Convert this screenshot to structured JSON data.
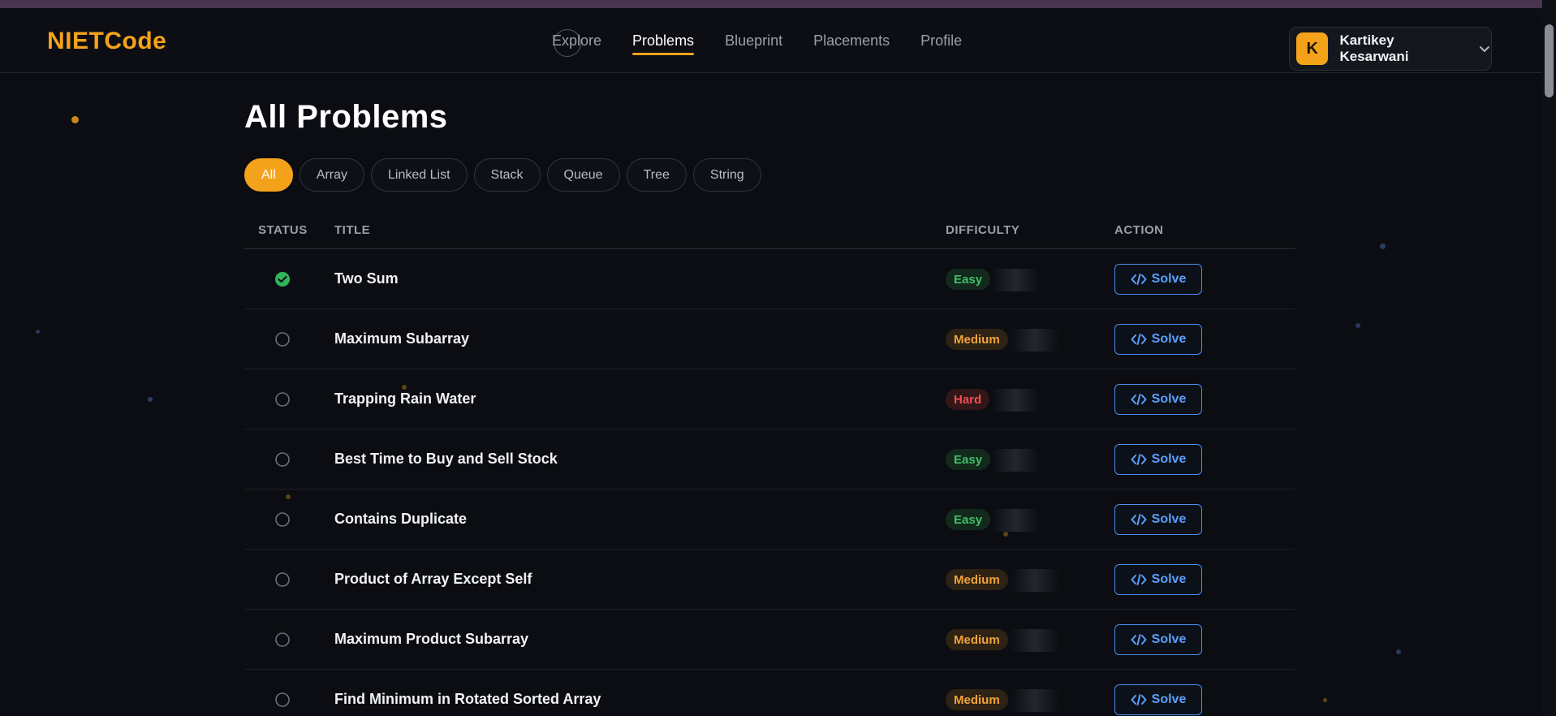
{
  "brand": {
    "name_part1": "NIET",
    "name_part2": "Code"
  },
  "nav": {
    "items": [
      {
        "label": "Explore",
        "active": false
      },
      {
        "label": "Problems",
        "active": true
      },
      {
        "label": "Blueprint",
        "active": false
      },
      {
        "label": "Placements",
        "active": false
      },
      {
        "label": "Profile",
        "active": false
      }
    ]
  },
  "user": {
    "initial": "K",
    "name": "Kartikey Kesarwani"
  },
  "page": {
    "title": "All Problems"
  },
  "filters": [
    "All",
    "Array",
    "Linked List",
    "Stack",
    "Queue",
    "Tree",
    "String"
  ],
  "active_filter": "All",
  "table": {
    "headers": {
      "status": "STATUS",
      "title": "TITLE",
      "difficulty": "DIFFICULTY",
      "action": "ACTION"
    },
    "action_label": "Solve",
    "rows": [
      {
        "status": "solved",
        "title": "Two Sum",
        "difficulty": "Easy"
      },
      {
        "status": "unsolved",
        "title": "Maximum Subarray",
        "difficulty": "Medium"
      },
      {
        "status": "unsolved",
        "title": "Trapping Rain Water",
        "difficulty": "Hard"
      },
      {
        "status": "unsolved",
        "title": "Best Time to Buy and Sell Stock",
        "difficulty": "Easy"
      },
      {
        "status": "unsolved",
        "title": "Contains Duplicate",
        "difficulty": "Easy"
      },
      {
        "status": "unsolved",
        "title": "Product of Array Except Self",
        "difficulty": "Medium"
      },
      {
        "status": "unsolved",
        "title": "Maximum Product Subarray",
        "difficulty": "Medium"
      },
      {
        "status": "unsolved",
        "title": "Find Minimum in Rotated Sorted Array",
        "difficulty": "Medium"
      }
    ]
  },
  "colors": {
    "accent": "#f5a21b",
    "solve": "#4b8ff0",
    "easy": "#3fbf6a",
    "medium": "#f2a33a",
    "hard": "#ef4f4f"
  }
}
